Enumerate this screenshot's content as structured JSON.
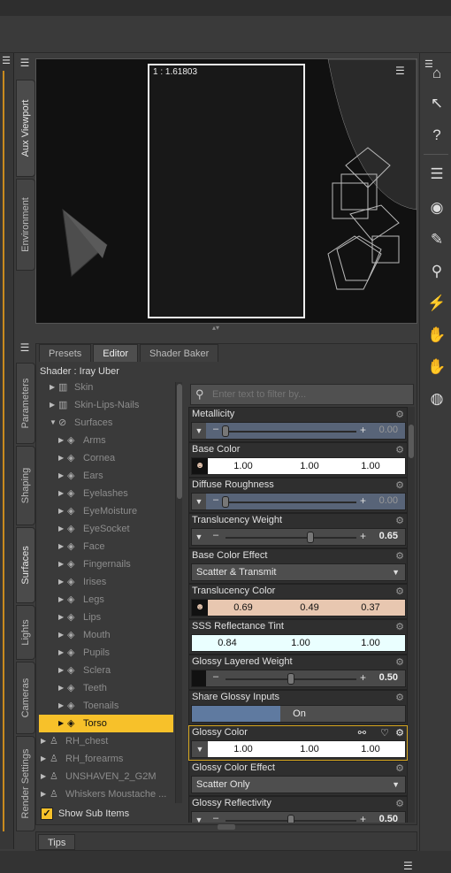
{
  "left_panel": {
    "vertical_tabs_top": [
      {
        "label": "Aux Viewport"
      },
      {
        "label": "Environment"
      }
    ],
    "vertical_tabs_bottom": [
      {
        "label": "Parameters"
      },
      {
        "label": "Shaping"
      },
      {
        "label": "Surfaces"
      },
      {
        "label": "Lights"
      },
      {
        "label": "Cameras"
      },
      {
        "label": "Render Settings"
      }
    ]
  },
  "viewport": {
    "aspect_ratio_label": "1 : 1.61803"
  },
  "surfaces": {
    "tabs": [
      {
        "label": "Presets"
      },
      {
        "label": "Editor"
      },
      {
        "label": "Shader Baker"
      }
    ],
    "shader_label": "Shader : Iray Uber",
    "filter_placeholder": "Enter text to filter by...",
    "tree": [
      {
        "label": "Skin"
      },
      {
        "label": "Skin-Lips-Nails"
      },
      {
        "label": "Surfaces"
      },
      {
        "label": "Arms"
      },
      {
        "label": "Cornea"
      },
      {
        "label": "Ears"
      },
      {
        "label": "Eyelashes"
      },
      {
        "label": "EyeMoisture"
      },
      {
        "label": "EyeSocket"
      },
      {
        "label": "Face"
      },
      {
        "label": "Fingernails"
      },
      {
        "label": "Irises"
      },
      {
        "label": "Legs"
      },
      {
        "label": "Lips"
      },
      {
        "label": "Mouth"
      },
      {
        "label": "Pupils"
      },
      {
        "label": "Sclera"
      },
      {
        "label": "Teeth"
      },
      {
        "label": "Toenails"
      },
      {
        "label": "Torso"
      },
      {
        "label": "RH_chest"
      },
      {
        "label": "RH_forearms"
      },
      {
        "label": "UNSHAVEN_2_G2M"
      },
      {
        "label": "Whiskers Moustache ..."
      }
    ],
    "selected_item": "Torso",
    "show_sub_items_label": "Show Sub Items",
    "properties": {
      "metallicity": {
        "label": "Metallicity",
        "value": "0.00",
        "fraction": 0.0
      },
      "base_color": {
        "label": "Base Color",
        "r": "1.00",
        "g": "1.00",
        "b": "1.00"
      },
      "diffuse_roughness": {
        "label": "Diffuse Roughness",
        "value": "0.00",
        "fraction": 0.0
      },
      "translucency_weight": {
        "label": "Translucency Weight",
        "value": "0.65",
        "fraction": 0.65
      },
      "base_color_effect": {
        "label": "Base Color Effect",
        "value": "Scatter & Transmit"
      },
      "translucency_color": {
        "label": "Translucency Color",
        "r": "0.69",
        "g": "0.49",
        "b": "0.37",
        "swatch": "#e8c7b0"
      },
      "sss_reflectance_tint": {
        "label": "SSS Reflectance Tint",
        "r": "0.84",
        "g": "1.00",
        "b": "1.00",
        "swatch": "#d6ffff"
      },
      "glossy_layered_weight": {
        "label": "Glossy Layered Weight",
        "value": "0.50",
        "fraction": 0.5
      },
      "share_glossy_inputs": {
        "label": "Share Glossy Inputs",
        "value": "On"
      },
      "glossy_color": {
        "label": "Glossy Color",
        "r": "1.00",
        "g": "1.00",
        "b": "1.00"
      },
      "glossy_color_effect": {
        "label": "Glossy Color Effect",
        "value": "Scatter Only"
      },
      "glossy_reflectivity": {
        "label": "Glossy Reflectivity",
        "value": "0.50",
        "fraction": 0.5
      }
    }
  },
  "bottom": {
    "tips_label": "Tips"
  },
  "colors": {
    "accent": "#f7c12a",
    "slider_bg": "#586478",
    "panel_bg": "#3a3a3a"
  }
}
